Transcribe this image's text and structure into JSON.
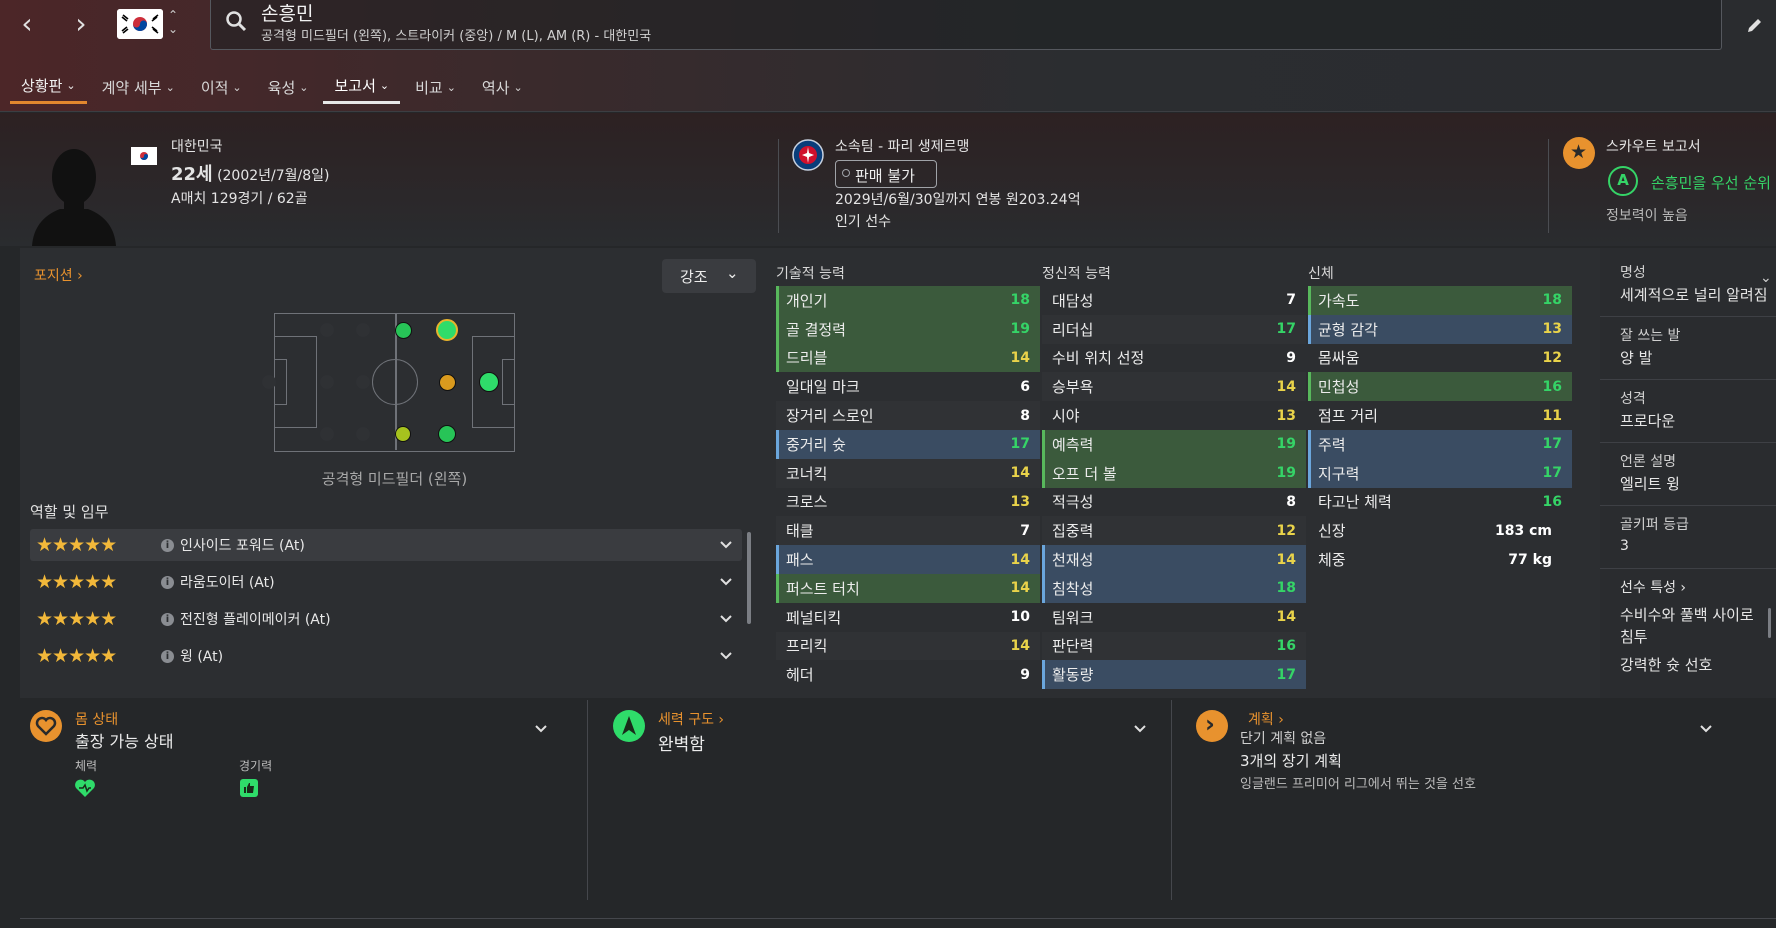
{
  "search": {
    "name": "손흥민",
    "subtitle": "공격형 미드필더 (왼쪽), 스트라이커 (중앙) / M (L), AM (R) - 대한민국"
  },
  "tabs": [
    {
      "label": "상황판"
    },
    {
      "label": "계약 세부"
    },
    {
      "label": "이적"
    },
    {
      "label": "육성"
    },
    {
      "label": "보고서"
    },
    {
      "label": "비교"
    },
    {
      "label": "역사"
    }
  ],
  "profile": {
    "nation": "대한민국",
    "age": "22세",
    "dob": "(2002년/7월/8일)",
    "caps": "A매치 129경기 / 62골"
  },
  "club": {
    "name": "소속팀 - 파리 생제르맹",
    "status": "판매 불가",
    "contract": "2029년/6월/30일까지 연봉 원203.24억",
    "popularity": "인기 선수"
  },
  "scout": {
    "title": "스카우트 보고서",
    "grade": "A",
    "recommendation": "손흥민을 우선 순위",
    "knowledge": "정보력이 높음"
  },
  "position": {
    "title": "포지션",
    "highlight_button": "강조",
    "caption": "공격형 미드필더 (왼쪽)",
    "roles_title": "역할 및 임무",
    "roles": [
      {
        "stars": "★★★★★",
        "label": "인사이드 포워드 (At)"
      },
      {
        "stars": "★★★★★",
        "label": "라움도이터 (At)"
      },
      {
        "stars": "★★★★★",
        "label": "전진형 플레이메이커 (At)"
      },
      {
        "stars": "★★★★★",
        "label": "윙 (At)"
      }
    ]
  },
  "technical": {
    "title": "기술적 능력",
    "attrs": [
      {
        "name": "개인기",
        "value": "18"
      },
      {
        "name": "골 결정력",
        "value": "19"
      },
      {
        "name": "드리블",
        "value": "14"
      },
      {
        "name": "일대일 마크",
        "value": "6"
      },
      {
        "name": "장거리 스로인",
        "value": "8"
      },
      {
        "name": "중거리 슛",
        "value": "17"
      },
      {
        "name": "코너킥",
        "value": "14"
      },
      {
        "name": "크로스",
        "value": "13"
      },
      {
        "name": "태클",
        "value": "7"
      },
      {
        "name": "패스",
        "value": "14"
      },
      {
        "name": "퍼스트 터치",
        "value": "14"
      },
      {
        "name": "페널티킥",
        "value": "10"
      },
      {
        "name": "프리킥",
        "value": "14"
      },
      {
        "name": "헤더",
        "value": "9"
      }
    ]
  },
  "mental": {
    "title": "정신적 능력",
    "attrs": [
      {
        "name": "대담성",
        "value": "7"
      },
      {
        "name": "리더십",
        "value": "17"
      },
      {
        "name": "수비 위치 선정",
        "value": "9"
      },
      {
        "name": "승부욕",
        "value": "14"
      },
      {
        "name": "시야",
        "value": "13"
      },
      {
        "name": "예측력",
        "value": "19"
      },
      {
        "name": "오프 더 볼",
        "value": "19"
      },
      {
        "name": "적극성",
        "value": "8"
      },
      {
        "name": "집중력",
        "value": "12"
      },
      {
        "name": "천재성",
        "value": "14"
      },
      {
        "name": "침착성",
        "value": "18"
      },
      {
        "name": "팀워크",
        "value": "14"
      },
      {
        "name": "판단력",
        "value": "16"
      },
      {
        "name": "활동량",
        "value": "17"
      }
    ]
  },
  "physical": {
    "title": "신체",
    "attrs": [
      {
        "name": "가속도",
        "value": "18"
      },
      {
        "name": "균형 감각",
        "value": "13"
      },
      {
        "name": "몸싸움",
        "value": "12"
      },
      {
        "name": "민첩성",
        "value": "16"
      },
      {
        "name": "점프 거리",
        "value": "11"
      },
      {
        "name": "주력",
        "value": "17"
      },
      {
        "name": "지구력",
        "value": "17"
      },
      {
        "name": "타고난 체력",
        "value": "16"
      },
      {
        "name": "신장",
        "value": "183 cm"
      },
      {
        "name": "체중",
        "value": "77 kg"
      }
    ]
  },
  "side": {
    "reputation_label": "명성",
    "reputation_value": "세계적으로 널리 알려짐",
    "foot_label": "잘 쓰는 발",
    "foot_value": "양 발",
    "personality_label": "성격",
    "personality_value": "프로다운",
    "media_label": "언론 설명",
    "media_value": "엘리트 윙",
    "gk_label": "골키퍼 등급",
    "gk_value": "3",
    "traits_label": "선수 특성",
    "trait1": "수비수와 풀백 사이로 침투",
    "trait2": "강력한 슛 선호"
  },
  "condition": {
    "title": "몸 상태",
    "value": "출장 가능 상태",
    "stamina_label": "체력",
    "sharpness_label": "경기력"
  },
  "dynamics": {
    "title": "세력 구도",
    "value": "완벽함"
  },
  "plans": {
    "title": "계획",
    "line1": "단기 계획 없음",
    "line2": "3개의 장기 계획",
    "line3": "잉글랜드 프리미어 리그에서 뛰는 것을 선호"
  },
  "colors": {
    "accent": "#e2872e",
    "green": "#35d467",
    "yellow": "#e9d34a",
    "blue_hl": "#3a4c62",
    "green_hl": "#3b5a3c"
  }
}
